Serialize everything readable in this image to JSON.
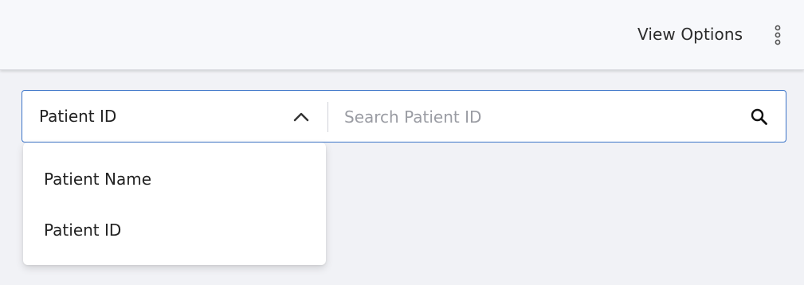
{
  "header": {
    "view_options_label": "View Options",
    "more_icon": "more-vertical-icon"
  },
  "search": {
    "field_select_value": "Patient ID",
    "placeholder": "Search Patient ID",
    "chevron_icon": "chevron-up-icon",
    "search_icon": "search-icon"
  },
  "dropdown": {
    "items": [
      {
        "label": "Patient Name"
      },
      {
        "label": "Patient ID"
      }
    ]
  },
  "colors": {
    "accent_border": "#3a73c7",
    "background": "#f1f2f6",
    "header_background": "#f7f8fb"
  }
}
